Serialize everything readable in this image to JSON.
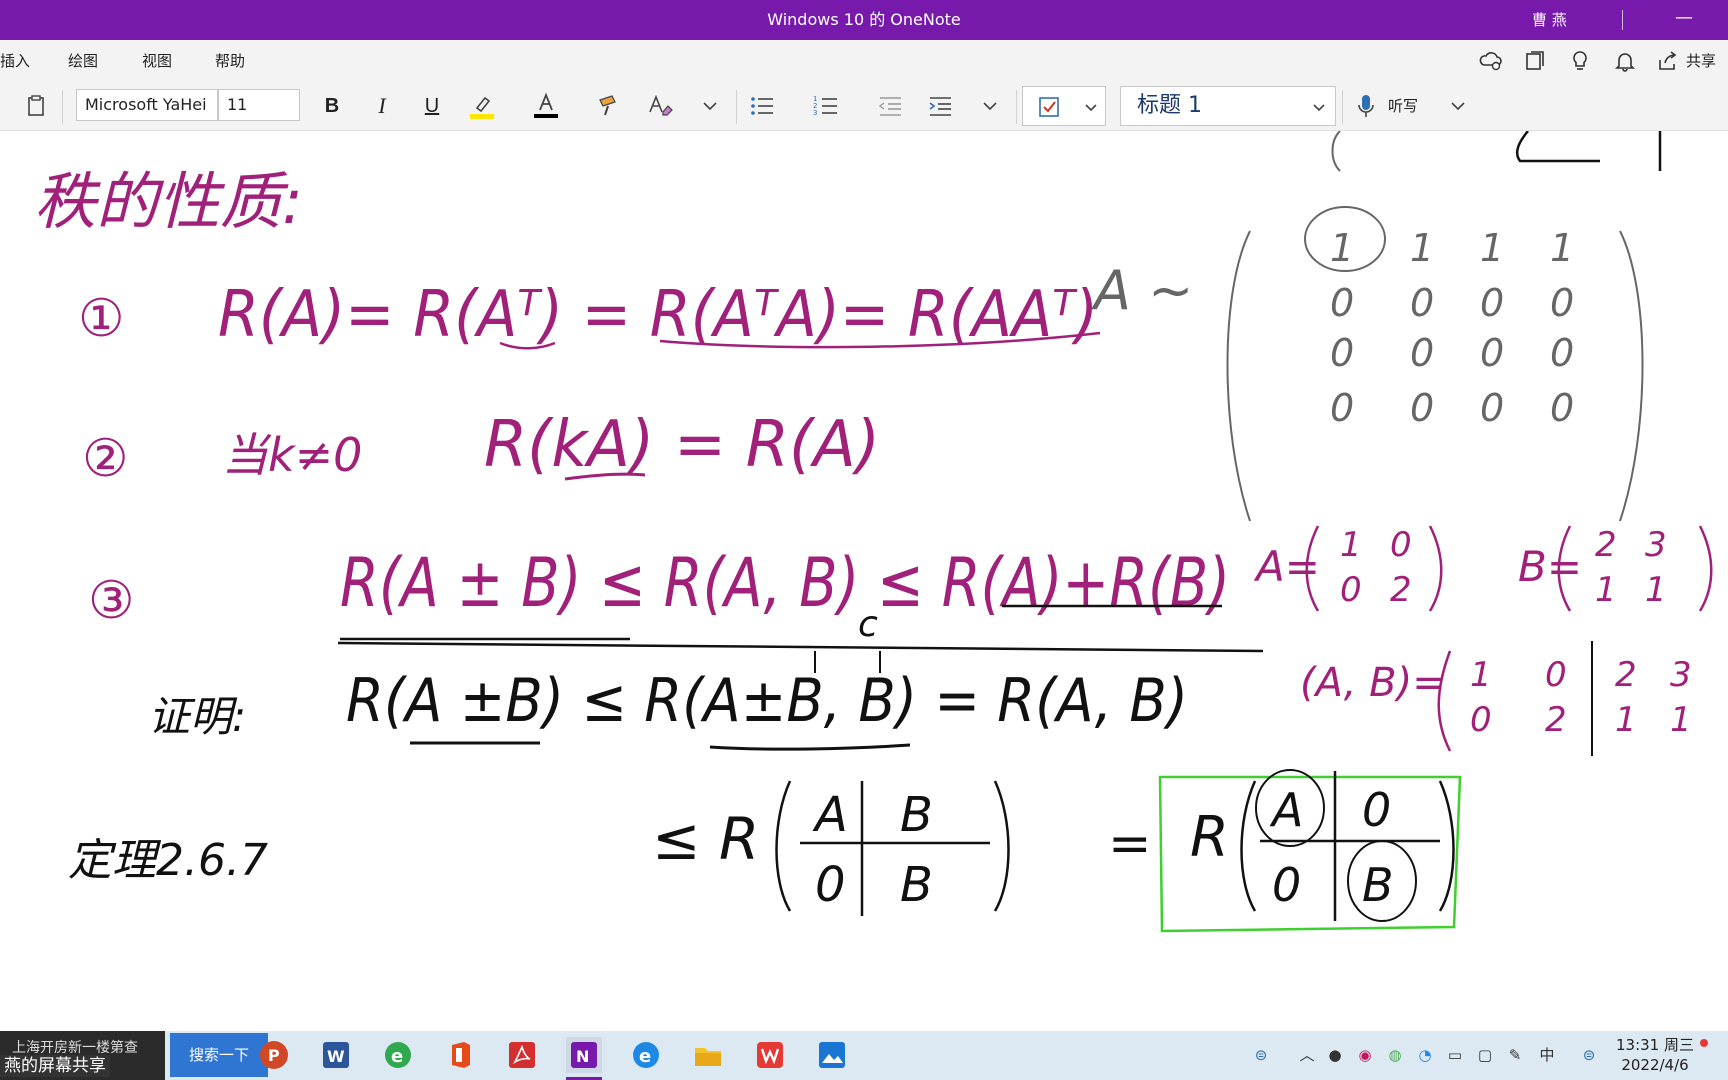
{
  "window": {
    "title": "Windows 10 的 OneNote",
    "user": "曹 燕",
    "minimize_glyph": "—"
  },
  "menu": {
    "items": [
      "插入",
      "绘图",
      "视图",
      "帮助"
    ],
    "share_label": "共享"
  },
  "ribbon": {
    "font_name": "Microsoft YaHei",
    "font_size": "11",
    "bold": "B",
    "italic": "I",
    "underline": "U",
    "style_value": "标题 1",
    "dictate_label": "听写",
    "colors": {
      "highlight": "#ffe500",
      "font_color": "#000000",
      "check": "#c0392b"
    }
  },
  "note": {
    "heading": "秩的性质:",
    "prop1_num": "①",
    "prop1_formula": "R(A)= R(Aᵀ) = R(AᵀA)= R(AAᵀ)",
    "prop1_side": "A ~",
    "matrix_rows": [
      [
        "1",
        "1",
        "1",
        "1"
      ],
      [
        "0",
        "0",
        "0",
        "0"
      ],
      [
        "0",
        "0",
        "0",
        "0"
      ],
      [
        "0",
        "0",
        "0",
        "0"
      ]
    ],
    "prop2_num": "②",
    "prop2_cond": "当k≠0",
    "prop2_formula": "R(kA) = R(A)",
    "prop3_num": "③",
    "prop3_formula": "R(A ± B) ≤ R(A, B) ≤ R(A)+R(B)",
    "prop3_a": "A=",
    "prop3_a_matrix": [
      [
        "1",
        "0"
      ],
      [
        "0",
        "2"
      ]
    ],
    "prop3_b": "B=",
    "prop3_b_matrix": [
      [
        "2",
        "3"
      ],
      [
        "1",
        "1"
      ]
    ],
    "c_label": "c",
    "proof_label": "证明:",
    "proof_line1": "R(A ±B) ≤ R(A±B, B) = R(A, B)",
    "ab_label": "(A, B)=",
    "ab_matrix": [
      [
        "1",
        "0",
        "2",
        "3"
      ],
      [
        "0",
        "2",
        "1",
        "1"
      ]
    ],
    "proof_line2_left": "≤ R",
    "block_top": [
      "A",
      "B"
    ],
    "block_bottom": [
      "0",
      "B"
    ],
    "equals": "=",
    "boxed_prefix": "R",
    "boxed_top": [
      "A",
      "0"
    ],
    "boxed_bottom": [
      "0",
      "B"
    ],
    "theorem_ref": "定理2.6.7",
    "colors": {
      "ink_purple": "#a0207a",
      "ink_black": "#111111",
      "ink_gray": "#666666",
      "ink_green": "#3fcf2f"
    }
  },
  "taskbar": {
    "left_label_top": "上海开房新一楼第查",
    "left_label_bottom": "燕的屏幕共享",
    "search_button": "搜索一下",
    "apps": [
      "powerpoint-icon",
      "word-icon",
      "ie-icon",
      "office-icon",
      "acrobat-icon",
      "onenote-icon",
      "edge-icon",
      "explorer-icon",
      "wps-icon",
      "photos-icon"
    ],
    "tray_ime": "中",
    "time": "13:31 周三",
    "date": "2022/4/6"
  }
}
